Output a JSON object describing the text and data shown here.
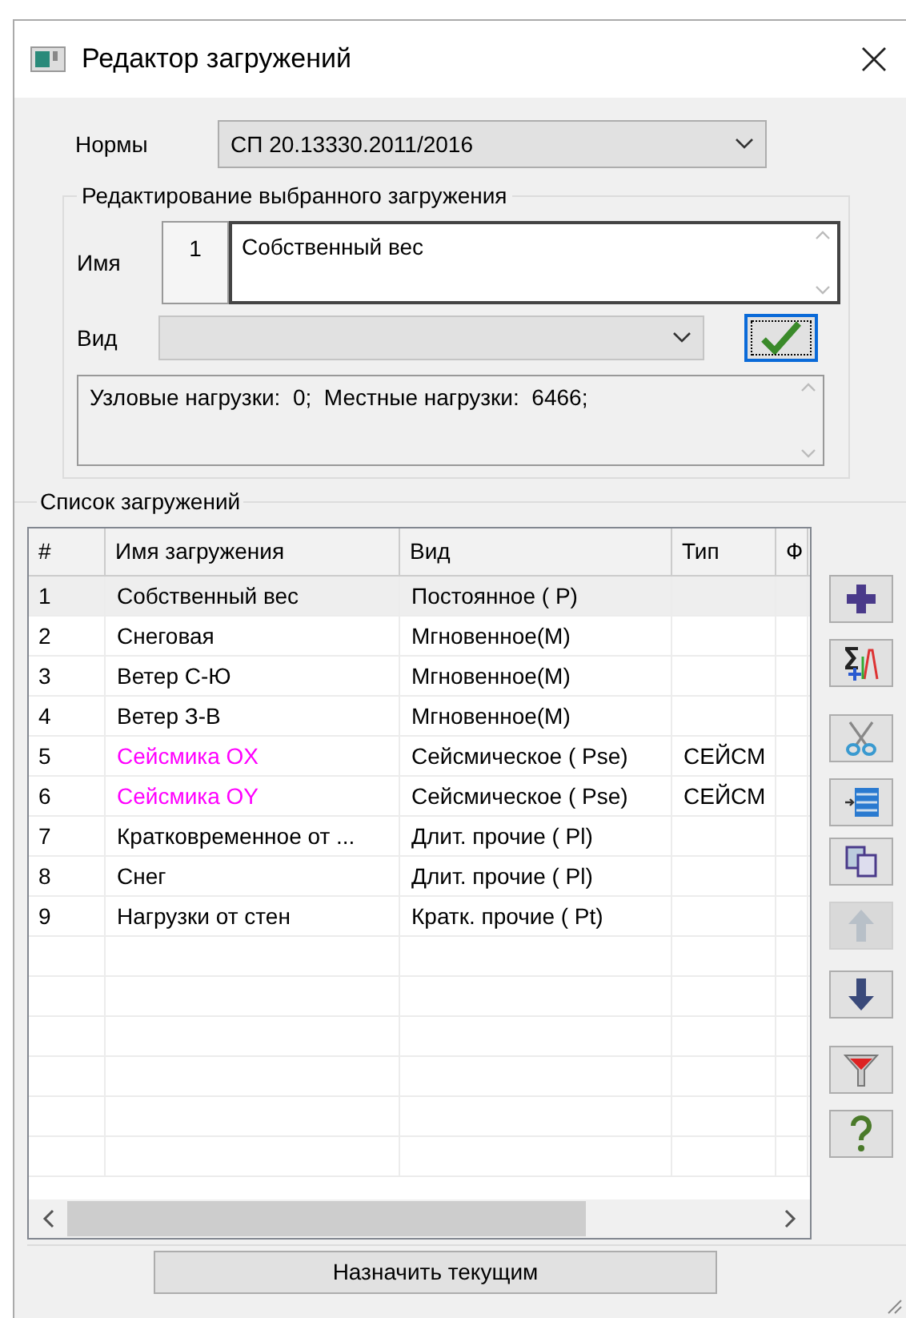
{
  "window": {
    "title": "Редактор загружений"
  },
  "norms": {
    "label": "Нормы",
    "value": "СП 20.13330.2011/2016"
  },
  "edit_group": {
    "title": "Редактирование выбранного загружения",
    "name_label": "Имя",
    "number": "1",
    "name_value": "Собственный вес",
    "kind_label": "Вид",
    "info": "Узловые нагрузки:  0;  Местные нагрузки:  6466;"
  },
  "list_group": {
    "title": "Список загружений"
  },
  "table": {
    "columns": [
      "#",
      "Имя загружения",
      "Вид",
      "Тип",
      "Ф"
    ],
    "rows": [
      {
        "cells": [
          "1",
          "Собственный вес",
          "Постоянное ( P)"
        ],
        "color": "#000000",
        "selected": true
      },
      {
        "cells": [
          "2",
          "Снеговая",
          "Мгновенное(M)"
        ],
        "color": "#000000",
        "selected": false
      },
      {
        "cells": [
          "3",
          "Ветер С-Ю",
          "Мгновенное(M)"
        ],
        "color": "#000000",
        "selected": false
      },
      {
        "cells": [
          "4",
          "Ветер З-В",
          "Мгновенное(M)"
        ],
        "color": "#000000",
        "selected": false
      },
      {
        "cells": [
          "5",
          "Сейсмика OX",
          "Сейсмическое ( Pse)",
          "СЕЙСМ"
        ],
        "color": "#ff00ff",
        "selected": false
      },
      {
        "cells": [
          "6",
          "Сейсмика OY",
          "Сейсмическое ( Pse)",
          "СЕЙСМ"
        ],
        "color": "#ff00ff",
        "selected": false
      },
      {
        "cells": [
          "7",
          "Кратковременное от ...",
          "Длит. прочие ( Pl)"
        ],
        "color": "#000000",
        "selected": false
      },
      {
        "cells": [
          "8",
          "Снег",
          "Длит. прочие ( Pl)"
        ],
        "color": "#000000",
        "selected": false
      },
      {
        "cells": [
          "9",
          "Нагрузки от стен",
          "Кратк. прочие ( Pt)"
        ],
        "color": "#000000",
        "selected": false
      }
    ]
  },
  "tool_buttons": [
    {
      "disabled": false
    },
    {
      "disabled": false
    },
    {
      "disabled": false
    },
    {
      "disabled": false
    },
    {
      "disabled": false
    },
    {
      "disabled": true
    },
    {
      "disabled": false
    },
    {
      "disabled": false
    },
    {
      "disabled": false
    }
  ],
  "assign_button": "Назначить текущим"
}
